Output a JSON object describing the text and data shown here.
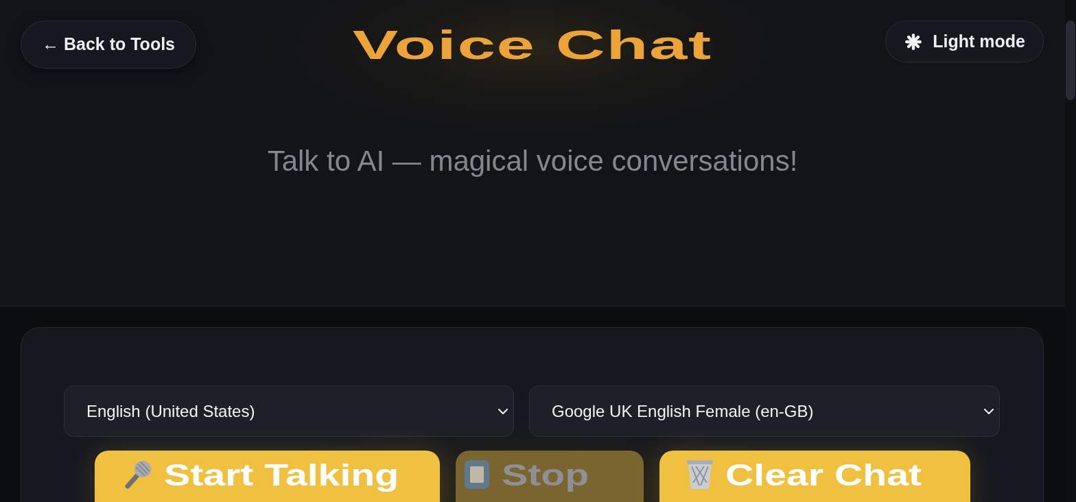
{
  "header": {
    "back_button": {
      "label": "← Back to Tools"
    },
    "title": "Voice Chat",
    "theme_button": {
      "label": "Light mode"
    },
    "subtitle": "Talk to AI — magical voice conversations!"
  },
  "controls": {
    "selects": [
      {
        "value": "English (United States)"
      },
      {
        "value": "Google UK English Female (en-GB)"
      }
    ],
    "buttons": [
      {
        "kind": "mic",
        "label": "Start Talking",
        "disabled": false
      },
      {
        "kind": "stop",
        "label": "Stop",
        "disabled": true
      },
      {
        "kind": "trash",
        "label": "Clear Chat",
        "disabled": false
      }
    ]
  }
}
